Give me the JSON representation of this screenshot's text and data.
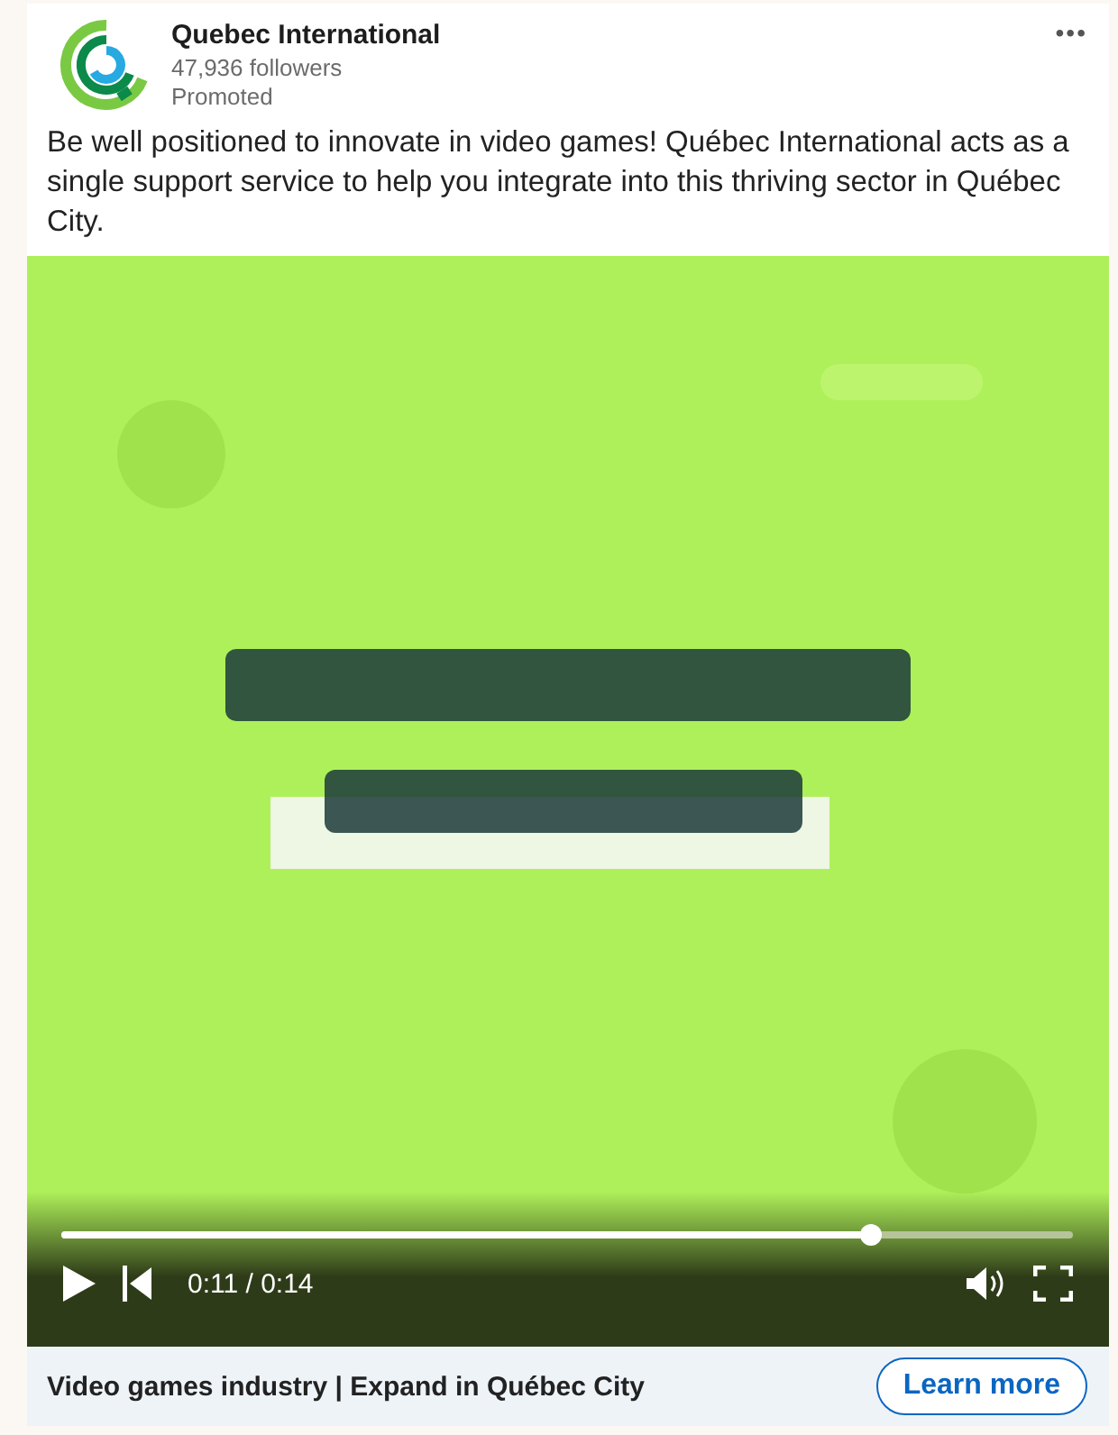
{
  "post": {
    "author": "Quebec International",
    "followers": "47,936 followers",
    "label": "Promoted",
    "menu": "•••",
    "text": "Be well positioned to innovate in video games! Québec International acts as a single support service to help you integrate into this thriving sector in Québec City."
  },
  "video": {
    "playing": false,
    "progress": {
      "level": 0.8
    },
    "time": "0:11 / 0:14"
  },
  "footer": {
    "headline": "Video games industry | Expand in Québec City",
    "button": "Learn more"
  }
}
